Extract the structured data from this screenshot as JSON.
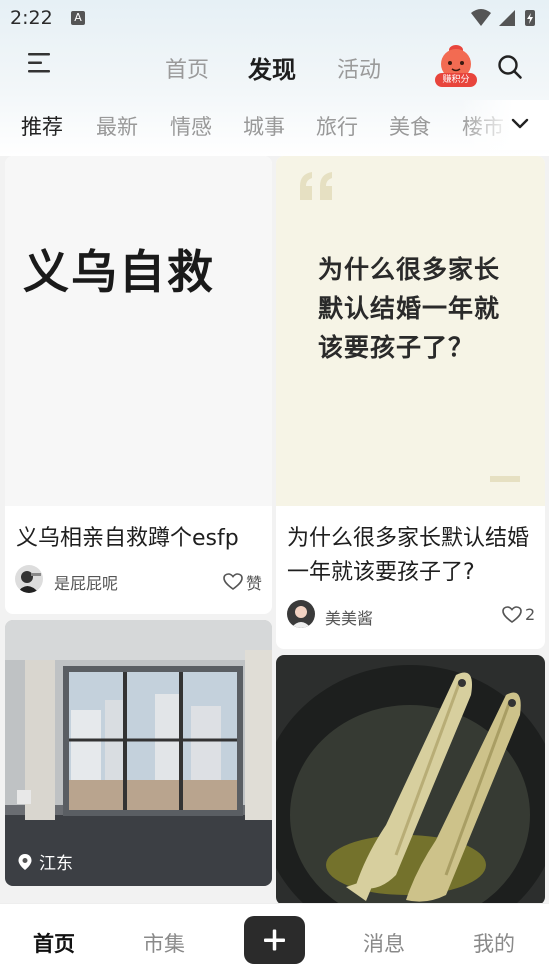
{
  "status_bar": {
    "time": "2:22",
    "notif_letter": "A"
  },
  "header": {
    "tabs": [
      {
        "label": "首页",
        "active": false
      },
      {
        "label": "发现",
        "active": true
      },
      {
        "label": "活动",
        "active": false
      }
    ],
    "points_badge": "赚积分"
  },
  "categories": [
    {
      "label": "推荐",
      "active": true
    },
    {
      "label": "最新",
      "active": false
    },
    {
      "label": "情感",
      "active": false
    },
    {
      "label": "城事",
      "active": false
    },
    {
      "label": "旅行",
      "active": false
    },
    {
      "label": "美食",
      "active": false
    },
    {
      "label": "楼市",
      "active": false
    }
  ],
  "feed": {
    "left": [
      {
        "cover_text": "义乌自救",
        "title": "义乌相亲自救蹲个esfp",
        "author": "是屁屁呢",
        "likes": "赞"
      },
      {
        "location": "江东"
      }
    ],
    "right": [
      {
        "cover_text": "为什么很多家长默认结婚一年就该要孩子了？",
        "title": "为什么很多家长默认结婚一年就该要孩子了?",
        "author": "美美酱",
        "likes": "2"
      },
      {}
    ]
  },
  "bottom_nav": {
    "items": [
      {
        "label": "首页",
        "active": true
      },
      {
        "label": "市集",
        "active": false
      },
      {
        "label": "消息",
        "active": false
      },
      {
        "label": "我的",
        "active": false
      }
    ]
  },
  "colors": {
    "accent": "#2b2b2b",
    "quote_card_bg": "#f6f4e6",
    "quote_mark": "#e6e0c2",
    "badge_red": "#e8453c"
  }
}
